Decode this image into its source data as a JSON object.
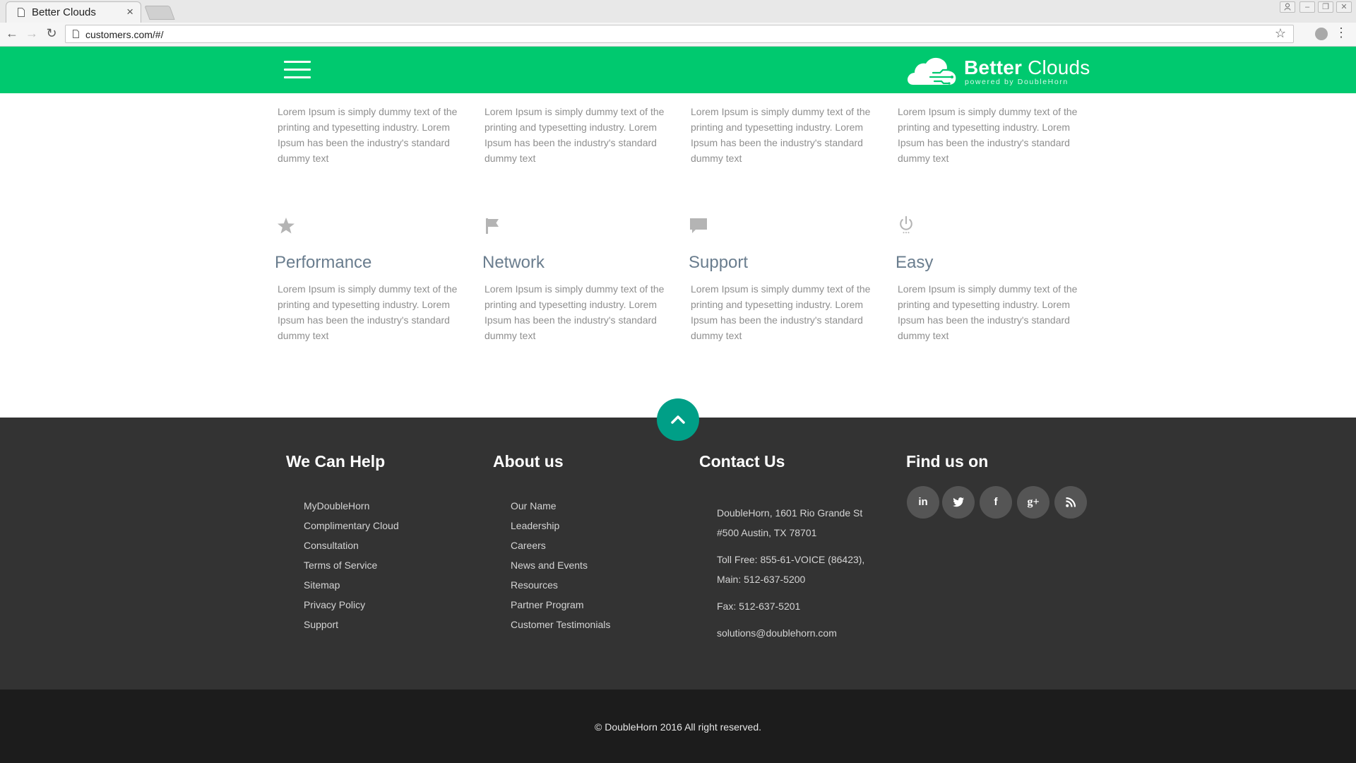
{
  "browser": {
    "tab_title": "Better Clouds",
    "tab_close": "×",
    "url": "customers.com/#/",
    "back": "←",
    "forward": "→",
    "reload": "↻",
    "bookmark": "☆",
    "menu": "⋮"
  },
  "header": {
    "brand_bold": "Better",
    "brand_light": " Clouds",
    "tagline": "powered by DoubleHorn",
    "accent_color": "#00c96f"
  },
  "features": {
    "top_row": [
      {
        "desc": "Lorem Ipsum is simply dummy text of the printing and typesetting industry. Lorem Ipsum has been the industry's standard dummy text"
      },
      {
        "desc": "Lorem Ipsum is simply dummy text of the printing and typesetting industry. Lorem Ipsum has been the industry's standard dummy text"
      },
      {
        "desc": "Lorem Ipsum is simply dummy text of the printing and typesetting industry. Lorem Ipsum has been the industry's standard dummy text"
      },
      {
        "desc": "Lorem Ipsum is simply dummy text of the printing and typesetting industry. Lorem Ipsum has been the industry's standard dummy text"
      }
    ],
    "bottom_row": [
      {
        "icon": "star-icon",
        "title": "Performance",
        "desc": "Lorem Ipsum is simply dummy text of the printing and typesetting industry. Lorem Ipsum has been the industry's standard dummy text"
      },
      {
        "icon": "flag-icon",
        "title": "Network",
        "desc": "Lorem Ipsum is simply dummy text of the printing and typesetting industry. Lorem Ipsum has been the industry's standard dummy text"
      },
      {
        "icon": "chat-icon",
        "title": "Support",
        "desc": "Lorem Ipsum is simply dummy text of the printing and typesetting industry. Lorem Ipsum has been the industry's standard dummy text"
      },
      {
        "icon": "power-icon",
        "title": "Easy",
        "desc": "Lorem Ipsum is simply dummy text of the printing and typesetting industry. Lorem Ipsum has been the industry's standard dummy text"
      }
    ]
  },
  "footer": {
    "help": {
      "heading": "We Can Help",
      "links": [
        "MyDoubleHorn",
        "Complimentary Cloud",
        "Consultation",
        "Terms of Service",
        "Sitemap",
        "Privacy Policy",
        "Support"
      ]
    },
    "about": {
      "heading": "About us",
      "links": [
        "Our Name",
        "Leadership",
        "Careers",
        "News and Events",
        "Resources",
        "Partner Program",
        "Customer Testimonials"
      ]
    },
    "contact": {
      "heading": "Contact Us",
      "address_line1": "DoubleHorn, 1601 Rio Grande St",
      "address_line2": "#500 Austin, TX 78701",
      "tollfree": "Toll Free: 855-61-VOICE (86423),",
      "main": "Main: 512-637-5200",
      "fax": "Fax: 512-637-5201",
      "email": "solutions@doublehorn.com"
    },
    "social": {
      "heading": "Find us on",
      "icons": [
        {
          "name": "linkedin-icon",
          "glyph": "in"
        },
        {
          "name": "twitter-icon",
          "glyph": "t"
        },
        {
          "name": "facebook-icon",
          "glyph": "f"
        },
        {
          "name": "google-plus-icon",
          "glyph": "g+"
        },
        {
          "name": "rss-icon",
          "glyph": "rss"
        }
      ]
    },
    "copyright": "© DoubleHorn 2016 All right reserved."
  }
}
